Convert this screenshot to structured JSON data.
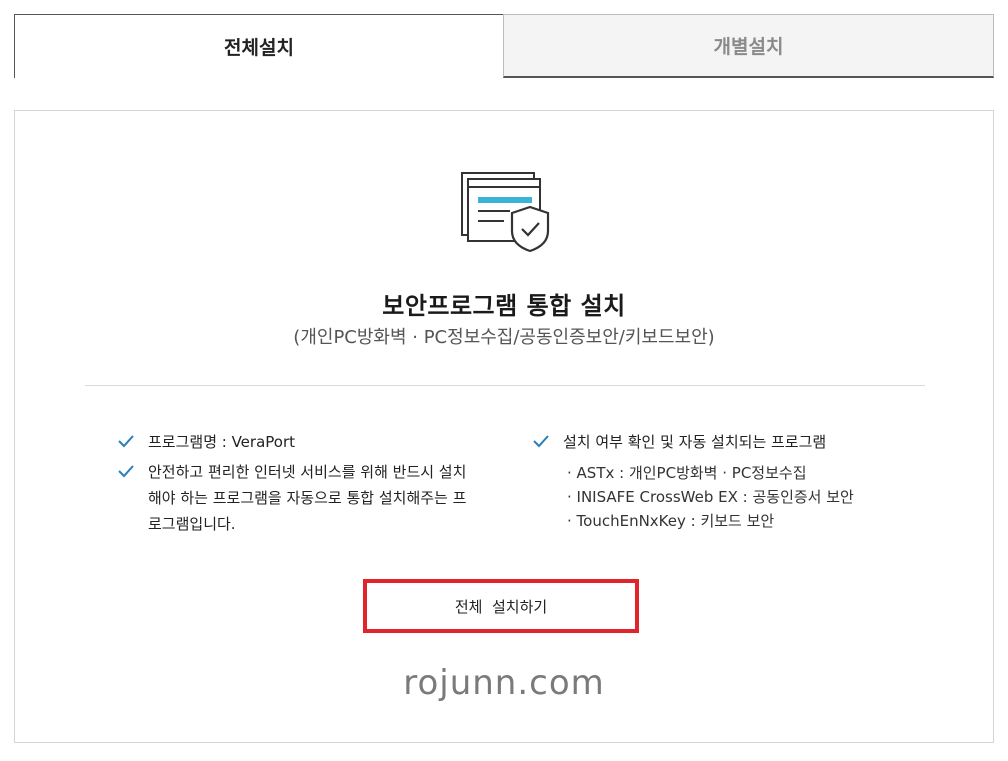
{
  "tabs": [
    {
      "label": "전체설치",
      "active": true
    },
    {
      "label": "개별설치",
      "active": false
    }
  ],
  "hero": {
    "icon": "security-program-icon",
    "title": "보안프로그램 통합 설치",
    "subtitle": "(개인PC방화벽 · PC정보수집/공동인증보안/키보드보안)"
  },
  "left_list": [
    {
      "text": "프로그램명 : VeraPort"
    },
    {
      "text": "안전하고 편리한 인터넷 서비스를 위해 반드시 설치해야 하는 프로그램을 자동으로 통합 설치해주는 프로그램입니다."
    }
  ],
  "right_list": {
    "heading": "설치 여부 확인 및 자동 설치되는 프로그램",
    "items": [
      "· ASTx : 개인PC방화벽 · PC정보수집",
      "· INISAFE CrossWeb EX : 공동인증서 보안",
      "· TouchEnNxKey : 키보드 보안"
    ]
  },
  "install_button": {
    "label": "전체  설치하기"
  },
  "watermark": "rojunn.com",
  "colors": {
    "accent_check": "#2a7fb8",
    "highlight_border": "#e0242b",
    "icon_bar": "#3bb3d6"
  }
}
